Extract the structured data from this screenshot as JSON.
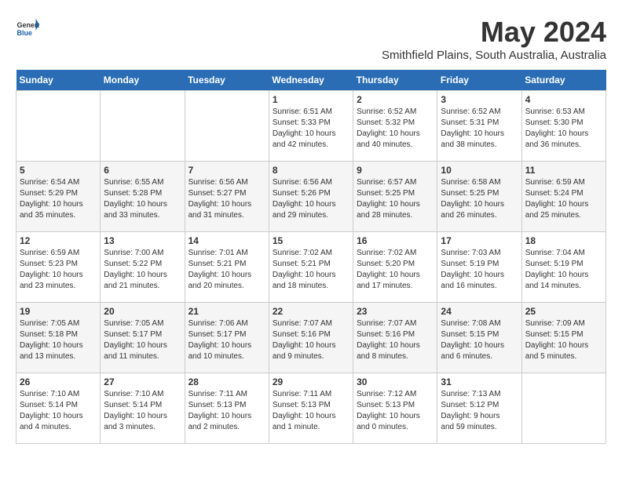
{
  "header": {
    "logo_general": "General",
    "logo_blue": "Blue",
    "month_title": "May 2024",
    "subtitle": "Smithfield Plains, South Australia, Australia"
  },
  "weekdays": [
    "Sunday",
    "Monday",
    "Tuesday",
    "Wednesday",
    "Thursday",
    "Friday",
    "Saturday"
  ],
  "weeks": [
    [
      {
        "num": "",
        "info": ""
      },
      {
        "num": "",
        "info": ""
      },
      {
        "num": "",
        "info": ""
      },
      {
        "num": "1",
        "info": "Sunrise: 6:51 AM\nSunset: 5:33 PM\nDaylight: 10 hours\nand 42 minutes."
      },
      {
        "num": "2",
        "info": "Sunrise: 6:52 AM\nSunset: 5:32 PM\nDaylight: 10 hours\nand 40 minutes."
      },
      {
        "num": "3",
        "info": "Sunrise: 6:52 AM\nSunset: 5:31 PM\nDaylight: 10 hours\nand 38 minutes."
      },
      {
        "num": "4",
        "info": "Sunrise: 6:53 AM\nSunset: 5:30 PM\nDaylight: 10 hours\nand 36 minutes."
      }
    ],
    [
      {
        "num": "5",
        "info": "Sunrise: 6:54 AM\nSunset: 5:29 PM\nDaylight: 10 hours\nand 35 minutes."
      },
      {
        "num": "6",
        "info": "Sunrise: 6:55 AM\nSunset: 5:28 PM\nDaylight: 10 hours\nand 33 minutes."
      },
      {
        "num": "7",
        "info": "Sunrise: 6:56 AM\nSunset: 5:27 PM\nDaylight: 10 hours\nand 31 minutes."
      },
      {
        "num": "8",
        "info": "Sunrise: 6:56 AM\nSunset: 5:26 PM\nDaylight: 10 hours\nand 29 minutes."
      },
      {
        "num": "9",
        "info": "Sunrise: 6:57 AM\nSunset: 5:25 PM\nDaylight: 10 hours\nand 28 minutes."
      },
      {
        "num": "10",
        "info": "Sunrise: 6:58 AM\nSunset: 5:25 PM\nDaylight: 10 hours\nand 26 minutes."
      },
      {
        "num": "11",
        "info": "Sunrise: 6:59 AM\nSunset: 5:24 PM\nDaylight: 10 hours\nand 25 minutes."
      }
    ],
    [
      {
        "num": "12",
        "info": "Sunrise: 6:59 AM\nSunset: 5:23 PM\nDaylight: 10 hours\nand 23 minutes."
      },
      {
        "num": "13",
        "info": "Sunrise: 7:00 AM\nSunset: 5:22 PM\nDaylight: 10 hours\nand 21 minutes."
      },
      {
        "num": "14",
        "info": "Sunrise: 7:01 AM\nSunset: 5:21 PM\nDaylight: 10 hours\nand 20 minutes."
      },
      {
        "num": "15",
        "info": "Sunrise: 7:02 AM\nSunset: 5:21 PM\nDaylight: 10 hours\nand 18 minutes."
      },
      {
        "num": "16",
        "info": "Sunrise: 7:02 AM\nSunset: 5:20 PM\nDaylight: 10 hours\nand 17 minutes."
      },
      {
        "num": "17",
        "info": "Sunrise: 7:03 AM\nSunset: 5:19 PM\nDaylight: 10 hours\nand 16 minutes."
      },
      {
        "num": "18",
        "info": "Sunrise: 7:04 AM\nSunset: 5:19 PM\nDaylight: 10 hours\nand 14 minutes."
      }
    ],
    [
      {
        "num": "19",
        "info": "Sunrise: 7:05 AM\nSunset: 5:18 PM\nDaylight: 10 hours\nand 13 minutes."
      },
      {
        "num": "20",
        "info": "Sunrise: 7:05 AM\nSunset: 5:17 PM\nDaylight: 10 hours\nand 11 minutes."
      },
      {
        "num": "21",
        "info": "Sunrise: 7:06 AM\nSunset: 5:17 PM\nDaylight: 10 hours\nand 10 minutes."
      },
      {
        "num": "22",
        "info": "Sunrise: 7:07 AM\nSunset: 5:16 PM\nDaylight: 10 hours\nand 9 minutes."
      },
      {
        "num": "23",
        "info": "Sunrise: 7:07 AM\nSunset: 5:16 PM\nDaylight: 10 hours\nand 8 minutes."
      },
      {
        "num": "24",
        "info": "Sunrise: 7:08 AM\nSunset: 5:15 PM\nDaylight: 10 hours\nand 6 minutes."
      },
      {
        "num": "25",
        "info": "Sunrise: 7:09 AM\nSunset: 5:15 PM\nDaylight: 10 hours\nand 5 minutes."
      }
    ],
    [
      {
        "num": "26",
        "info": "Sunrise: 7:10 AM\nSunset: 5:14 PM\nDaylight: 10 hours\nand 4 minutes."
      },
      {
        "num": "27",
        "info": "Sunrise: 7:10 AM\nSunset: 5:14 PM\nDaylight: 10 hours\nand 3 minutes."
      },
      {
        "num": "28",
        "info": "Sunrise: 7:11 AM\nSunset: 5:13 PM\nDaylight: 10 hours\nand 2 minutes."
      },
      {
        "num": "29",
        "info": "Sunrise: 7:11 AM\nSunset: 5:13 PM\nDaylight: 10 hours\nand 1 minute."
      },
      {
        "num": "30",
        "info": "Sunrise: 7:12 AM\nSunset: 5:13 PM\nDaylight: 10 hours\nand 0 minutes."
      },
      {
        "num": "31",
        "info": "Sunrise: 7:13 AM\nSunset: 5:12 PM\nDaylight: 9 hours\nand 59 minutes."
      },
      {
        "num": "",
        "info": ""
      }
    ]
  ]
}
